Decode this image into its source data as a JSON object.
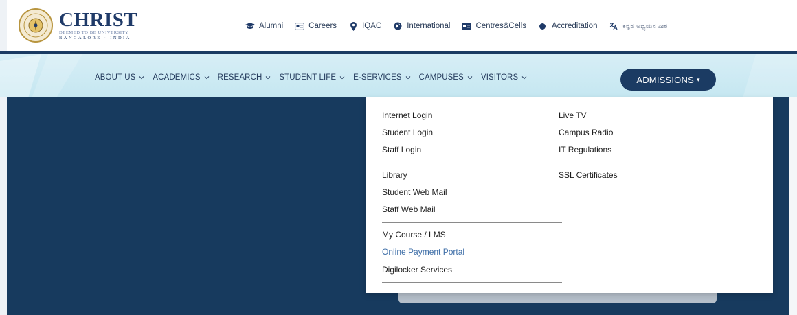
{
  "header": {
    "logo": {
      "name": "CHRIST",
      "subtitle": "DEEMED TO BE UNIVERSITY",
      "location": "BANGALORE · INDIA"
    },
    "top_links": [
      {
        "label": "Alumni",
        "icon": "graduation-cap-icon"
      },
      {
        "label": "Careers",
        "icon": "id-card-icon"
      },
      {
        "label": "IQAC",
        "icon": "map-pin-icon"
      },
      {
        "label": "International",
        "icon": "globe-icon"
      },
      {
        "label": "Centres&Cells",
        "icon": "building-badge-icon"
      },
      {
        "label": "Accreditation",
        "icon": "dot-icon"
      },
      {
        "label": "ಕನ್ನಡ ಅಧ್ಯಯನ ಪೀಠ",
        "icon": "language-icon"
      }
    ]
  },
  "nav": {
    "items": [
      {
        "label": "ABOUT US"
      },
      {
        "label": "ACADEMICS"
      },
      {
        "label": "RESEARCH"
      },
      {
        "label": "STUDENT LIFE"
      },
      {
        "label": "E-SERVICES"
      },
      {
        "label": "CAMPUSES"
      },
      {
        "label": "VISITORS"
      }
    ],
    "admissions_label": "ADMISSIONS",
    "admissions_caret": "▾"
  },
  "dropdown": {
    "left_groups": [
      [
        "Internet Login",
        "Student Login",
        "Staff Login"
      ],
      [
        "Library",
        "Student Web Mail",
        "Staff Web Mail"
      ],
      [
        "My Course / LMS",
        "Online Payment Portal",
        "Digilocker Services"
      ]
    ],
    "right_groups": [
      [
        "Live TV",
        "Campus Radio",
        "IT Regulations"
      ],
      [
        "SSL Certificates"
      ]
    ],
    "highlighted_item": "Online Payment Portal"
  },
  "colors": {
    "navy": "#1b3b63",
    "main_background": "#173a5e",
    "nav_background": "#c5e7f1",
    "link_blue": "#3f6fa8"
  }
}
